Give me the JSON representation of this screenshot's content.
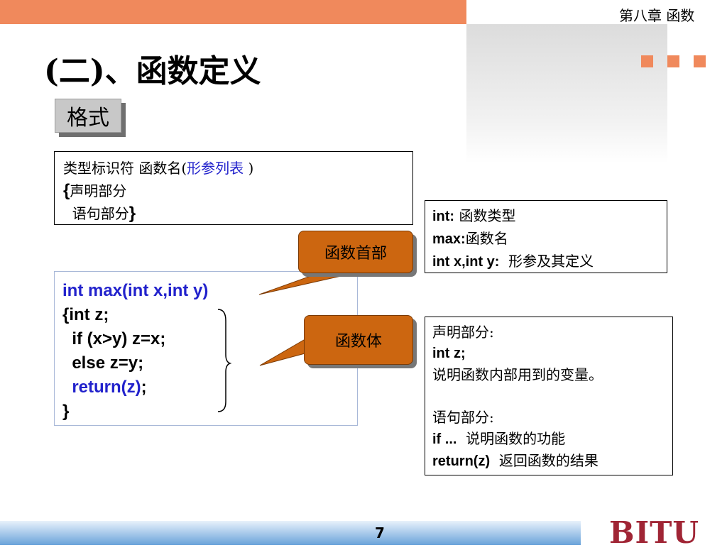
{
  "header": {
    "chapter": "第八章  函数"
  },
  "title": "(二)、函数定义",
  "tag": "格式",
  "syntax": {
    "line1_a": "类型标识符 函数名(",
    "line1_param": "形参列表",
    "line1_b": " )",
    "line2_brace": "{",
    "line2": "声明部分",
    "line3": "  语句部分",
    "line3_brace": "}"
  },
  "code": {
    "line1": "int max(int x,int y)",
    "line2": "{int z;",
    "line3": "  if (x>y) z=x;",
    "line4": "  else z=y;",
    "line5_kw": "return(z)",
    "line5_end": ";",
    "line6": "}"
  },
  "callouts": {
    "header": "函数首部",
    "body": "函数体"
  },
  "info_header": {
    "l1_b": "int:",
    "l1": " 函数类型",
    "l2_b": "max:",
    "l2": "函数名",
    "l3_b": "int x,int y:",
    "l3": "  形参及其定义"
  },
  "info_body": {
    "l1": "声明部分:",
    "l2_b": "int z;",
    "l3": "说明函数内部用到的变量。",
    "l4": "语句部分:",
    "l5_b": "if ...",
    "l5": "  说明函数的功能",
    "l6_b": "return(z)",
    "l6": "  返回函数的结果"
  },
  "footer": {
    "page": "7",
    "logo": "BITU"
  },
  "colors": {
    "accent": "#f0895c",
    "callout": "#cc6610",
    "keyword": "#2222cc",
    "logo": "#a02535"
  }
}
